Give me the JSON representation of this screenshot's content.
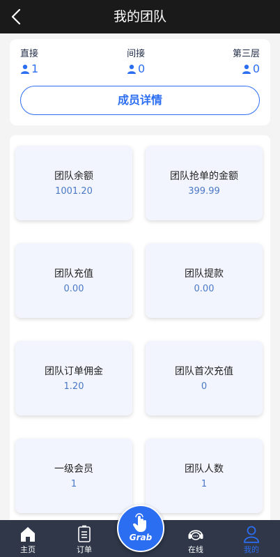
{
  "header": {
    "title": "我的团队",
    "back_icon": "chevron-left-icon"
  },
  "stats": {
    "direct": {
      "label": "直接",
      "value": "1"
    },
    "indirect": {
      "label": "间接",
      "value": "0"
    },
    "third": {
      "label": "第三层",
      "value": "0"
    },
    "icon": "user-icon"
  },
  "detail_button": "成员详情",
  "tiles": [
    {
      "label": "团队余额",
      "value": "1001.20"
    },
    {
      "label": "团队抢单的金额",
      "value": "399.99"
    },
    {
      "label": "团队充值",
      "value": "0.00"
    },
    {
      "label": "团队提款",
      "value": "0.00"
    },
    {
      "label": "团队订单佣金",
      "value": "1.20"
    },
    {
      "label": "团队首次充值",
      "value": "0"
    },
    {
      "label": "一级会员",
      "value": "1"
    },
    {
      "label": "团队人数",
      "value": "1"
    }
  ],
  "tabbar": {
    "home": "主页",
    "orders": "订单",
    "grab": "Grab",
    "online": "在线",
    "mine": "我的",
    "active": "mine"
  },
  "colors": {
    "accent": "#2c6ef2",
    "header_bg": "#1a1a1a",
    "tabbar_bg": "#2f3748",
    "tile_bg": "#f2f5fd"
  }
}
